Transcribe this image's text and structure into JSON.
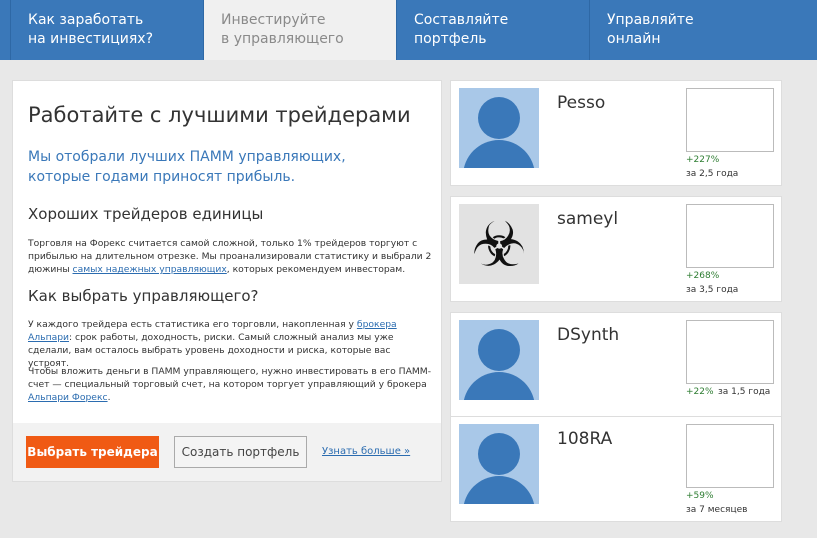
{
  "tabs": [
    {
      "line1": "Как заработать",
      "line2": "на инвестициях?"
    },
    {
      "line1": "Инвестируйте",
      "line2": "в управляющего"
    },
    {
      "line1": "Составляйте",
      "line2": "портфель"
    },
    {
      "line1": "Управляйте",
      "line2": "онлайн"
    }
  ],
  "main": {
    "title": "Работайте с лучшими трейдерами",
    "lead": "Мы отобрали лучших ПАММ управляющих, которые годами приносят прибыль.",
    "h2a": "Хороших трейдеров единицы",
    "p1a": "Торговля на Форекс считается самой сложной, только 1% трейдеров торгуют с прибылью на длительном отрезке. Мы проанализировали статистику и выбрали 2 дюжины ",
    "p1link": "самых надежных управляющих",
    "p1b": ", которых рекомендуем инвесторам.",
    "h2b": "Как выбрать управляющего?",
    "p2a": "У каждого трейдера есть статистика его торговли, накопленная у ",
    "p2link": "брокера Альпари",
    "p2b": ": срок работы, доходность, риски. Самый сложный анализ мы уже сделали, вам осталось выбрать уровень доходности и риска, которые вас устроят.",
    "p3a": "Чтобы вложить деньги в ПАММ управляющего, нужно инвестировать в его ПАММ-счет — специальный торговый счет, на котором торгует управляющий у брокера ",
    "p3link": "Альпари Форекс",
    "p3b": ".",
    "btn_choose": "Выбрать трейдера",
    "btn_portfolio": "Создать портфель",
    "more": "Узнать больше »"
  },
  "traders": [
    {
      "name": "Pesso",
      "return": "+227%",
      "period": "за 2,5 года"
    },
    {
      "name": "sameyl",
      "return": "+268%",
      "period": "за 3,5 года"
    },
    {
      "name": "DSynth",
      "return": "+22%",
      "period": "за 1,5 года"
    },
    {
      "name": "108RA",
      "return": "+59%",
      "period": "за 7 месяцев"
    }
  ]
}
